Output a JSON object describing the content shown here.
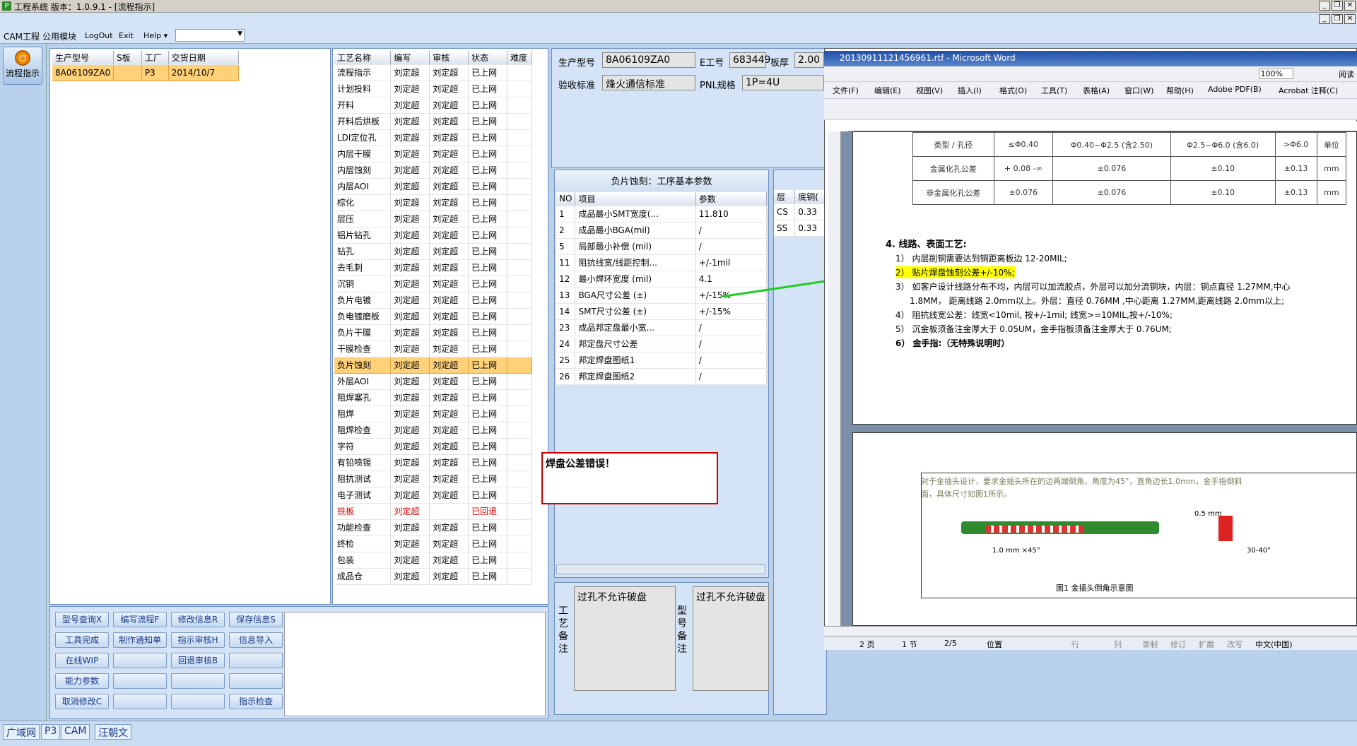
{
  "window": {
    "title": "工程系统    版本：1.0.9.1 - [流程指示]"
  },
  "menu": {
    "items": [
      "CAM工程",
      "公用模块",
      "LogOut",
      "Exit",
      "Help ▾"
    ]
  },
  "sidebar": {
    "flow_label": "流程指示"
  },
  "orders": {
    "headers": [
      "生产型号",
      "S板",
      "工厂",
      "交货日期"
    ],
    "rows": [
      [
        "8A06109ZA0",
        "",
        "P3",
        "2014/10/7"
      ]
    ]
  },
  "process": {
    "headers": [
      "工艺名称",
      "编写",
      "审核",
      "状态",
      "难度"
    ],
    "rows": [
      [
        "流程指示",
        "刘定超",
        "刘定超",
        "已上网",
        ""
      ],
      [
        "计划投料",
        "刘定超",
        "刘定超",
        "已上网",
        ""
      ],
      [
        "开料",
        "刘定超",
        "刘定超",
        "已上网",
        ""
      ],
      [
        "开料后烘板",
        "刘定超",
        "刘定超",
        "已上网",
        ""
      ],
      [
        "LDI定位孔",
        "刘定超",
        "刘定超",
        "已上网",
        ""
      ],
      [
        "内层干膜",
        "刘定超",
        "刘定超",
        "已上网",
        ""
      ],
      [
        "内层蚀刻",
        "刘定超",
        "刘定超",
        "已上网",
        ""
      ],
      [
        "内层AOI",
        "刘定超",
        "刘定超",
        "已上网",
        ""
      ],
      [
        "棕化",
        "刘定超",
        "刘定超",
        "已上网",
        ""
      ],
      [
        "层压",
        "刘定超",
        "刘定超",
        "已上网",
        ""
      ],
      [
        "铝片钻孔",
        "刘定超",
        "刘定超",
        "已上网",
        ""
      ],
      [
        "钻孔",
        "刘定超",
        "刘定超",
        "已上网",
        ""
      ],
      [
        "去毛刺",
        "刘定超",
        "刘定超",
        "已上网",
        ""
      ],
      [
        "沉铜",
        "刘定超",
        "刘定超",
        "已上网",
        ""
      ],
      [
        "负片电镀",
        "刘定超",
        "刘定超",
        "已上网",
        ""
      ],
      [
        "负电镀磨板",
        "刘定超",
        "刘定超",
        "已上网",
        ""
      ],
      [
        "负片干膜",
        "刘定超",
        "刘定超",
        "已上网",
        ""
      ],
      [
        "干膜检查",
        "刘定超",
        "刘定超",
        "已上网",
        ""
      ],
      [
        "负片蚀刻",
        "刘定超",
        "刘定超",
        "已上网",
        ""
      ],
      [
        "外层AOI",
        "刘定超",
        "刘定超",
        "已上网",
        ""
      ],
      [
        "阻焊塞孔",
        "刘定超",
        "刘定超",
        "已上网",
        ""
      ],
      [
        "阻焊",
        "刘定超",
        "刘定超",
        "已上网",
        ""
      ],
      [
        "阻焊检查",
        "刘定超",
        "刘定超",
        "已上网",
        ""
      ],
      [
        "字符",
        "刘定超",
        "刘定超",
        "已上网",
        ""
      ],
      [
        "有铅喷锡",
        "刘定超",
        "刘定超",
        "已上网",
        ""
      ],
      [
        "阻抗测试",
        "刘定超",
        "刘定超",
        "已上网",
        ""
      ],
      [
        "电子测试",
        "刘定超",
        "刘定超",
        "已上网",
        ""
      ],
      [
        "铣板",
        "刘定超",
        "",
        "已回退",
        ""
      ],
      [
        "功能检查",
        "刘定超",
        "刘定超",
        "已上网",
        ""
      ],
      [
        "终检",
        "刘定超",
        "刘定超",
        "已上网",
        ""
      ],
      [
        "包装",
        "刘定超",
        "刘定超",
        "已上网",
        ""
      ],
      [
        "成品仓",
        "刘定超",
        "刘定超",
        "已上网",
        ""
      ]
    ]
  },
  "buttons": [
    [
      "型号查询X",
      "编写流程F",
      "修改信息R",
      "保存信息S"
    ],
    [
      "工具完成",
      "制作通知单",
      "指示审核H",
      "信息导入"
    ],
    [
      "在线WIP",
      "",
      "回退审核B",
      ""
    ],
    [
      "能力参数",
      "",
      "",
      ""
    ],
    [
      "取消修改C",
      "",
      "",
      "指示检查"
    ]
  ],
  "info": {
    "model_label": "生产型号",
    "model": "8A06109ZA0",
    "e_label": "E工号",
    "e": "683449",
    "thick_label": "板厚",
    "thick": "2.00",
    "std_label": "验收标准",
    "std": "烽火通信标准",
    "pnl_label": "PNL规格",
    "pnl": "1P=4U"
  },
  "params": {
    "title": "负片蚀刻：工序基本参数",
    "headers": [
      "NO",
      "项目",
      "参数"
    ],
    "rows": [
      [
        "1",
        "成品最小SMT宽度(...",
        "11.810"
      ],
      [
        "2",
        "成品最小BGA(mil)",
        "/"
      ],
      [
        "5",
        "局部最小补偿 (mil)",
        "/"
      ],
      [
        "11",
        "阻抗线宽/线距控制...",
        "+/-1mil"
      ],
      [
        "12",
        "最小焊环宽度 (mil)",
        "4.1"
      ],
      [
        "13",
        "BGA尺寸公差 (±)",
        "+/-15%"
      ],
      [
        "14",
        "SMT尺寸公差 (±)",
        "+/-15%"
      ],
      [
        "23",
        "成品邦定盘最小宽...",
        "/"
      ],
      [
        "24",
        "邦定盘尺寸公差",
        "/"
      ],
      [
        "25",
        "邦定焊盘图纸1",
        "/"
      ],
      [
        "26",
        "邦定焊盘图纸2",
        "/"
      ]
    ]
  },
  "layers": {
    "headers": [
      "层",
      "底铜("
    ],
    "rows": [
      [
        "CS",
        "0.33"
      ],
      [
        "SS",
        "0.33"
      ]
    ]
  },
  "annotation": {
    "text": "焊盘公差错误！"
  },
  "remarks": {
    "label1": "工艺备注",
    "text1": "过孔不允许破盘",
    "label2": "型号备注",
    "text2": "过孔不允许破盘"
  },
  "word": {
    "title": "20130911121456961.rtf - Microsoft Word",
    "menu": [
      "文件(F)",
      "编辑(E)",
      "视图(V)",
      "插入(I)",
      "格式(O)",
      "工具(T)",
      "表格(A)",
      "窗口(W)",
      "帮助(H)",
      "Adobe PDF(B)",
      "Acrobat 注释(C)"
    ],
    "zoom": "100%",
    "read": "阅读",
    "table": [
      [
        "类型 / 孔径",
        "≤Φ0.40",
        "Φ0.40~Φ2.5 (含2.50)",
        "Φ2.5~Φ6.0 (含6.0)",
        ">Φ6.0",
        "单位"
      ],
      [
        "金属化孔公差",
        "+ 0.08 -∞",
        "±0.076",
        "±0.10",
        "±0.13",
        "mm"
      ],
      [
        "非金属化孔公差",
        "±0.076",
        "±0.076",
        "±0.10",
        "±0.13",
        "mm"
      ]
    ],
    "heading": "4.  线路、表面工艺:",
    "lines": [
      "1） 内层削铜需要达到铜距离板边 12-20MIL;",
      "2） 贴片焊盘蚀刻公差+/-10%;",
      "3） 如客户设计线路分布不均，内层可以加流胶点，外层可以加分流铜块，内层：铜点直径 1.27MM,中心",
      "1.8MM， 距离线路 2.0mm以上。外层：直径 0.76MM ,中心距离 1.27MM,距离线路 2.0mm以上;",
      "4） 阻抗线宽公差：线宽<10mil, 按+/-1mil; 线宽>=10MIL,按+/-10%;",
      "5） 沉金板须备注金厚大于 0.05UM，金手指板须备注金厚大于 0.76UM;",
      "6） 金手指:（无特殊说明时）"
    ],
    "fig_text": "对于金插头设计，要求金插头所在的边两端倒角，角度为45°，直角边长1.0mm，金手指倒斜",
    "fig_text2": "面，具体尺寸如图1所示。",
    "fig_caption": "图1   金插头倒角示意图",
    "fig_l1": "1.0 mm ×45°",
    "fig_l2": "0.5 mm",
    "fig_l3": "30-40°",
    "status": [
      "2 页",
      "1 节",
      "2/5",
      "位置",
      "行",
      "列",
      "录制",
      "修订",
      "扩展",
      "改写",
      "中文(中国)"
    ]
  },
  "taskbar": [
    "广域网",
    "P3",
    "CAM",
    "汪朝文"
  ],
  "colors": {
    "highlight": "#ffff00",
    "arrow": "#22cc22",
    "annot_border": "#cc0000"
  }
}
